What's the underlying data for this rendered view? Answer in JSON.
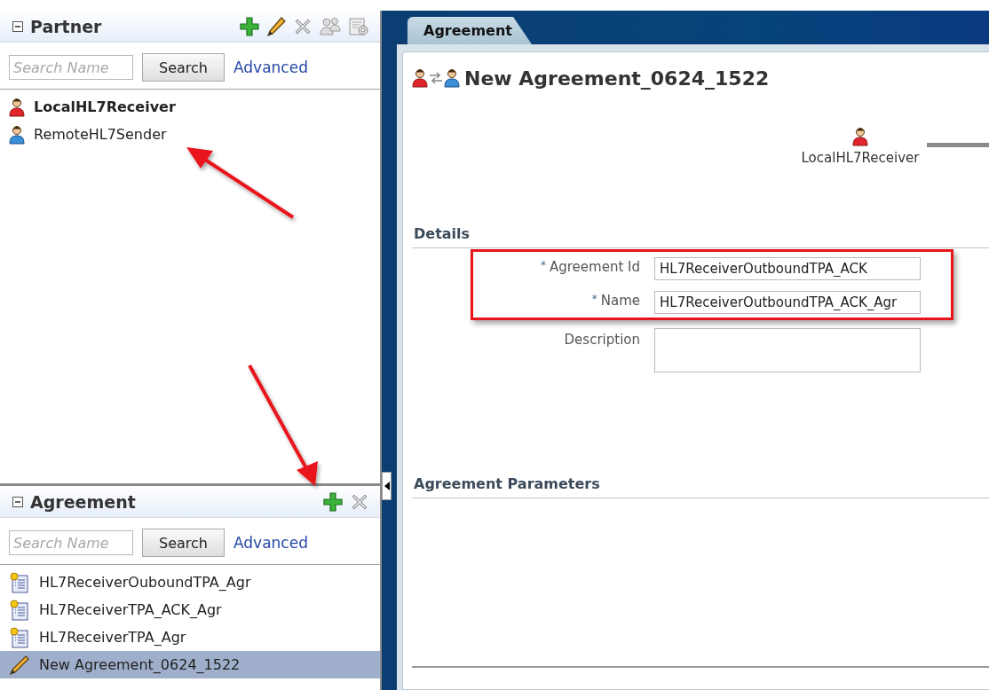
{
  "partner_panel": {
    "title": "Partner",
    "search": {
      "placeholder": "Search Name",
      "button": "Search",
      "advanced": "Advanced"
    },
    "items": [
      {
        "label": "LocalHL7Receiver",
        "kind": "local"
      },
      {
        "label": "RemoteHL7Sender",
        "kind": "remote"
      }
    ]
  },
  "agreement_panel": {
    "title": "Agreement",
    "search": {
      "placeholder": "Search Name",
      "button": "Search",
      "advanced": "Advanced"
    },
    "items": [
      {
        "label": "HL7ReceiverOuboundTPA_Agr",
        "kind": "agreement",
        "selected": false
      },
      {
        "label": "HL7ReceiverTPA_ACK_Agr",
        "kind": "agreement",
        "selected": false
      },
      {
        "label": "HL7ReceiverTPA_Agr",
        "kind": "agreement",
        "selected": false
      },
      {
        "label": "New Agreement_0624_1522",
        "kind": "draft",
        "selected": true
      }
    ]
  },
  "tabs": [
    {
      "label": "Agreement",
      "selected": true
    }
  ],
  "editor": {
    "title": "New Agreement_0624_1522",
    "node": {
      "label": "LocalHL7Receiver",
      "kind": "local"
    },
    "details": {
      "title": "Details",
      "fields": [
        {
          "required_mark": "*",
          "label": "Agreement Id",
          "value": "HL7ReceiverOutboundTPA_ACK",
          "kind": "input"
        },
        {
          "required_mark": "*",
          "label": "Name",
          "value": "HL7ReceiverOutboundTPA_ACK_Agr",
          "kind": "input"
        },
        {
          "label": "Description",
          "kind": "textarea"
        }
      ]
    },
    "parameters": {
      "title": "Agreement Parameters"
    }
  }
}
